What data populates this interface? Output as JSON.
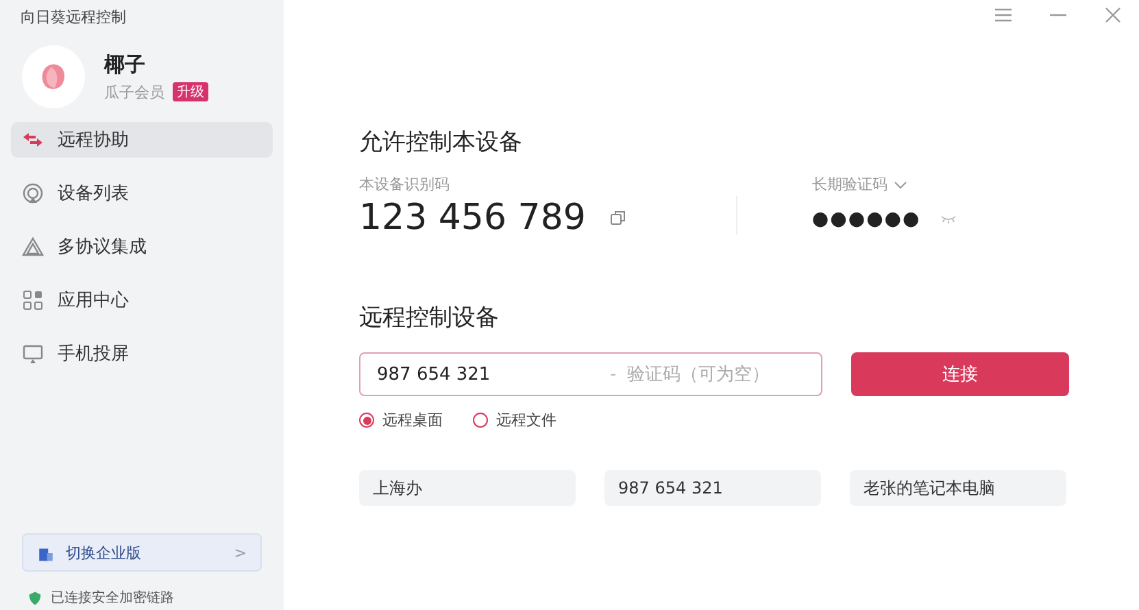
{
  "app_title": "向日葵远程控制",
  "user": {
    "name": "椰子",
    "membership": "瓜子会员",
    "badge": "升级"
  },
  "nav": [
    {
      "label": "远程协助",
      "selected": true
    },
    {
      "label": "设备列表",
      "selected": false
    },
    {
      "label": "多协议集成",
      "selected": false
    },
    {
      "label": "应用中心",
      "selected": false
    },
    {
      "label": "手机投屏",
      "selected": false
    }
  ],
  "enterprise_button": {
    "label": "切换企业版",
    "chevron": ">"
  },
  "status": {
    "text": "已连接安全加密链路"
  },
  "allow_section": {
    "title": "允许控制本设备",
    "id_label": "本设备识别码",
    "device_id": "123 456 789",
    "code_label": "长期验证码",
    "code_mask": "●●●●●●"
  },
  "control_section": {
    "title": "远程控制设备",
    "id_value": "987 654 321",
    "separator": "-",
    "code_placeholder": "验证码（可为空）",
    "connect_button": "连接",
    "modes": [
      {
        "label": "远程桌面",
        "selected": true
      },
      {
        "label": "远程文件",
        "selected": false
      }
    ],
    "history": [
      "上海办",
      "987 654 321",
      "老张的笔记本电脑"
    ]
  }
}
